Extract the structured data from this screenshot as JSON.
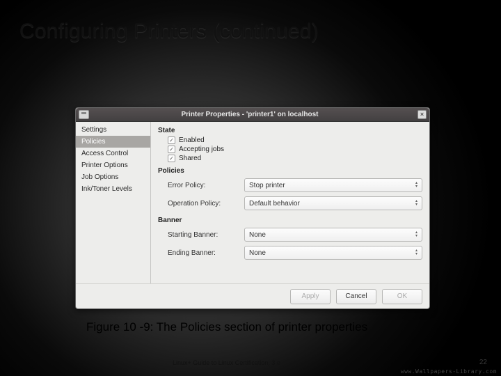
{
  "slide": {
    "title": "Configuring Printers (continued)",
    "caption": "Figure 10 -9: The Policies section of printer properties",
    "book": "Linux+ Guide to Linux Certification, 3 e",
    "page": "22",
    "watermark": "www.Wallpapers-Library.com"
  },
  "dialog": {
    "title": "Printer Properties - 'printer1' on localhost",
    "sidebar": [
      {
        "label": "Settings",
        "selected": false
      },
      {
        "label": "Policies",
        "selected": true
      },
      {
        "label": "Access Control",
        "selected": false
      },
      {
        "label": "Printer Options",
        "selected": false
      },
      {
        "label": "Job Options",
        "selected": false
      },
      {
        "label": "Ink/Toner Levels",
        "selected": false
      }
    ],
    "sections": {
      "state": {
        "heading": "State",
        "checks": [
          {
            "label": "Enabled",
            "checked": true
          },
          {
            "label": "Accepting jobs",
            "checked": true
          },
          {
            "label": "Shared",
            "checked": true
          }
        ]
      },
      "policies": {
        "heading": "Policies",
        "rows": [
          {
            "label": "Error Policy:",
            "value": "Stop printer"
          },
          {
            "label": "Operation Policy:",
            "value": "Default behavior"
          }
        ]
      },
      "banner": {
        "heading": "Banner",
        "rows": [
          {
            "label": "Starting Banner:",
            "value": "None"
          },
          {
            "label": "Ending Banner:",
            "value": "None"
          }
        ]
      }
    },
    "buttons": {
      "apply": "Apply",
      "cancel": "Cancel",
      "ok": "OK"
    }
  }
}
